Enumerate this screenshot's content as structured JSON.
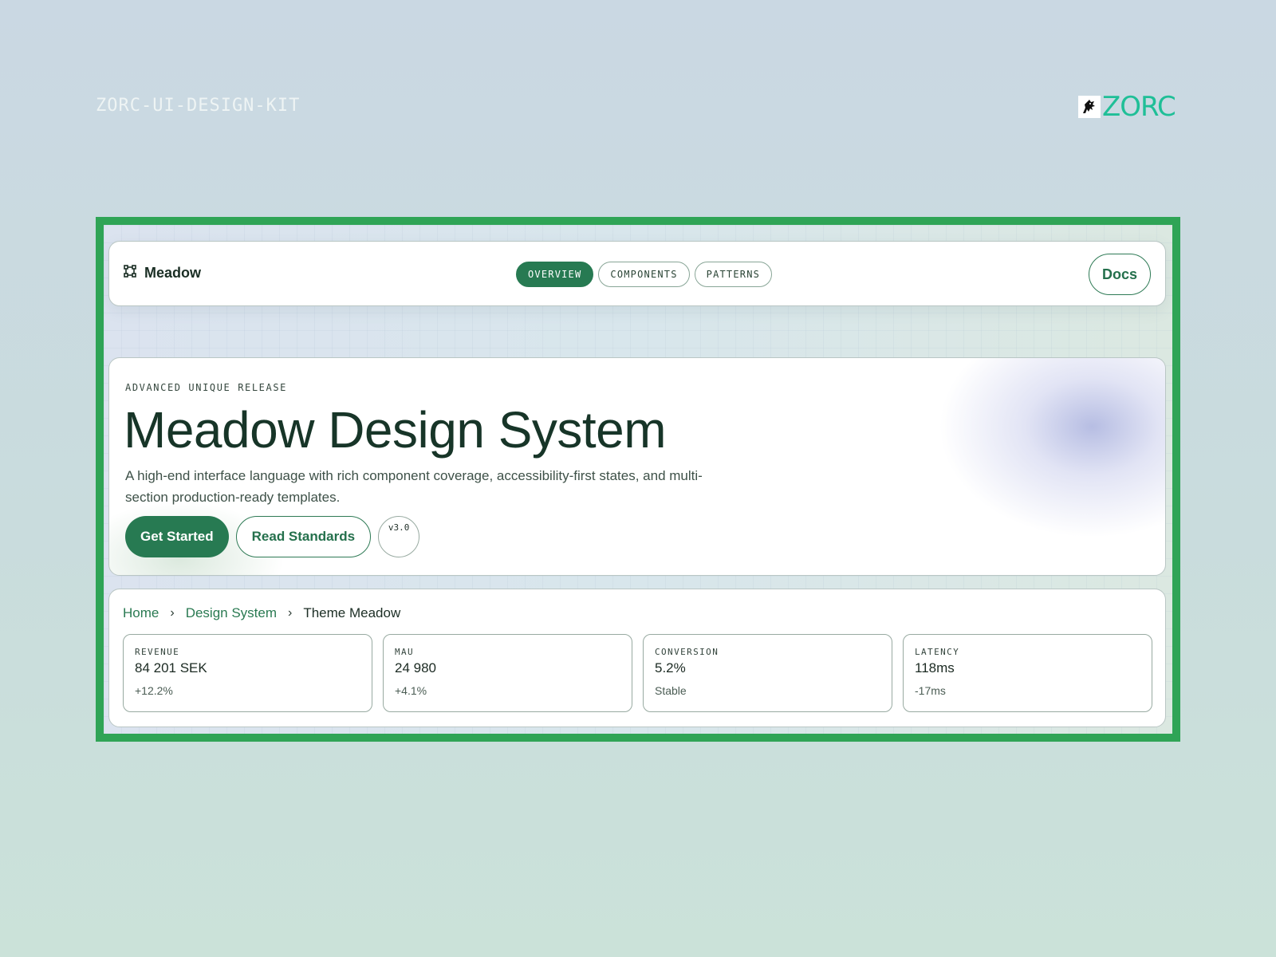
{
  "page": {
    "kit_label": "ZORC-UI-DESIGN-KIT",
    "brand": {
      "wordmark": "ZORC",
      "icon": "dog-mascot-icon",
      "color": "#1fbf97"
    },
    "frame_color": "#2fa456"
  },
  "nav": {
    "brand_icon": "frame-corners-icon",
    "brand_label": "Meadow",
    "tabs": [
      {
        "label": "OVERVIEW",
        "active": true
      },
      {
        "label": "COMPONENTS",
        "active": false
      },
      {
        "label": "PATTERNS",
        "active": false
      }
    ],
    "docs_label": "Docs"
  },
  "hero": {
    "eyebrow": "ADVANCED UNIQUE RELEASE",
    "title": "Meadow Design System",
    "description": "A high-end interface language with rich component coverage, accessibility-first states, and multi-section production-ready templates.",
    "primary_label": "Get Started",
    "secondary_label": "Read Standards",
    "version": "v3.0"
  },
  "breadcrumb": {
    "items": [
      "Home",
      "Design System",
      "Theme Meadow"
    ],
    "separator_icon": "chevron-right-icon"
  },
  "stats": [
    {
      "label": "REVENUE",
      "value": "84 201 SEK",
      "delta": "+12.2%"
    },
    {
      "label": "MAU",
      "value": "24 980",
      "delta": "+4.1%"
    },
    {
      "label": "CONVERSION",
      "value": "5.2%",
      "delta": "Stable"
    },
    {
      "label": "LATENCY",
      "value": "118ms",
      "delta": "-17ms"
    }
  ],
  "colors": {
    "accent": "#277a52",
    "ink": "#173528"
  }
}
